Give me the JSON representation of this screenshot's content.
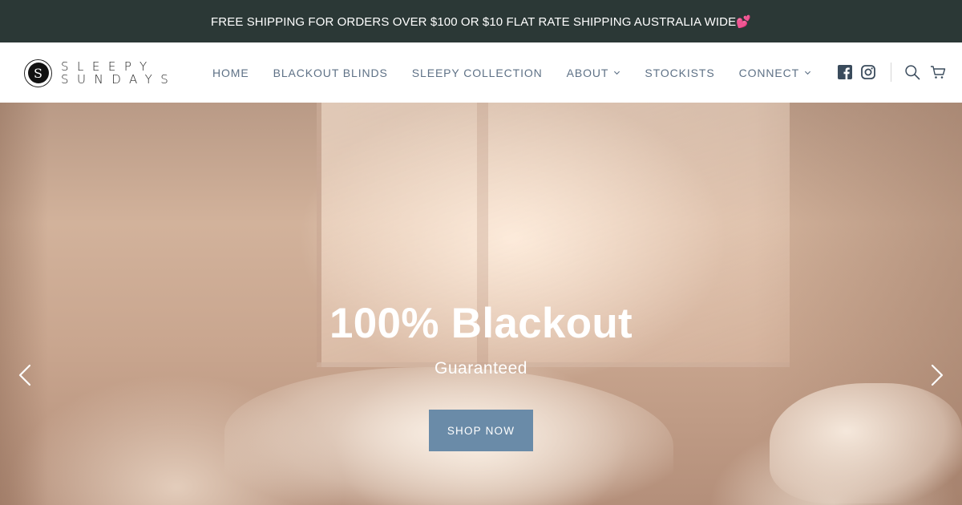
{
  "announcement": {
    "text": "FREE SHIPPING FOR ORDERS OVER $100 OR $10 FLAT RATE SHIPPING AUSTRALIA WIDE💕"
  },
  "logo": {
    "mark": "S",
    "line1": "SLEEPY",
    "line2": "SUNDAYS"
  },
  "nav": {
    "items": [
      {
        "label": "HOME",
        "has_dropdown": false
      },
      {
        "label": "BLACKOUT BLINDS",
        "has_dropdown": false
      },
      {
        "label": "SLEEPY COLLECTION",
        "has_dropdown": false
      },
      {
        "label": "ABOUT",
        "has_dropdown": true
      },
      {
        "label": "STOCKISTS",
        "has_dropdown": false
      },
      {
        "label": "CONNECT",
        "has_dropdown": true
      }
    ]
  },
  "utilities": {
    "icons": [
      "facebook-icon",
      "instagram-icon",
      "search-icon",
      "cart-icon"
    ]
  },
  "hero": {
    "title": "100% Blackout",
    "subtitle": "Guaranteed",
    "cta_label": "SHOP NOW",
    "prev_icon": "chevron-left-icon",
    "next_icon": "chevron-right-icon"
  },
  "colors": {
    "announcement_bg": "#2b3836",
    "nav_text": "#5e7186",
    "cta_bg": "#6a8ba8",
    "text_light": "#ffffff"
  }
}
